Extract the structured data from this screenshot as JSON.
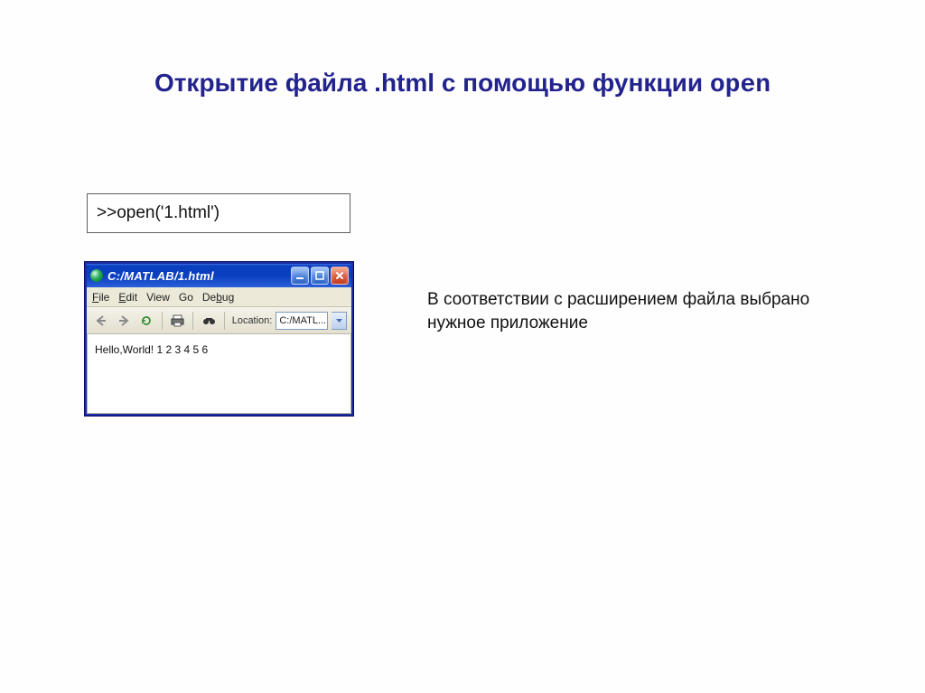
{
  "slide": {
    "title_prefix": "Открытие файла .html с помощью функции ",
    "title_keyword": "open"
  },
  "code": {
    "command": ">>open('1.html')"
  },
  "explanation": {
    "text": "В соответствии с расширением файла выбрано нужное приложение"
  },
  "browser": {
    "title": "C:/MATLAB/1.html",
    "menu": {
      "file": "File",
      "edit": "Edit",
      "view": "View",
      "go": "Go",
      "debug": "Debug"
    },
    "toolbar": {
      "location_label": "Location:",
      "location_value": "C:/MATL..."
    },
    "content": "Hello,World! 1 2 3 4 5 6"
  }
}
